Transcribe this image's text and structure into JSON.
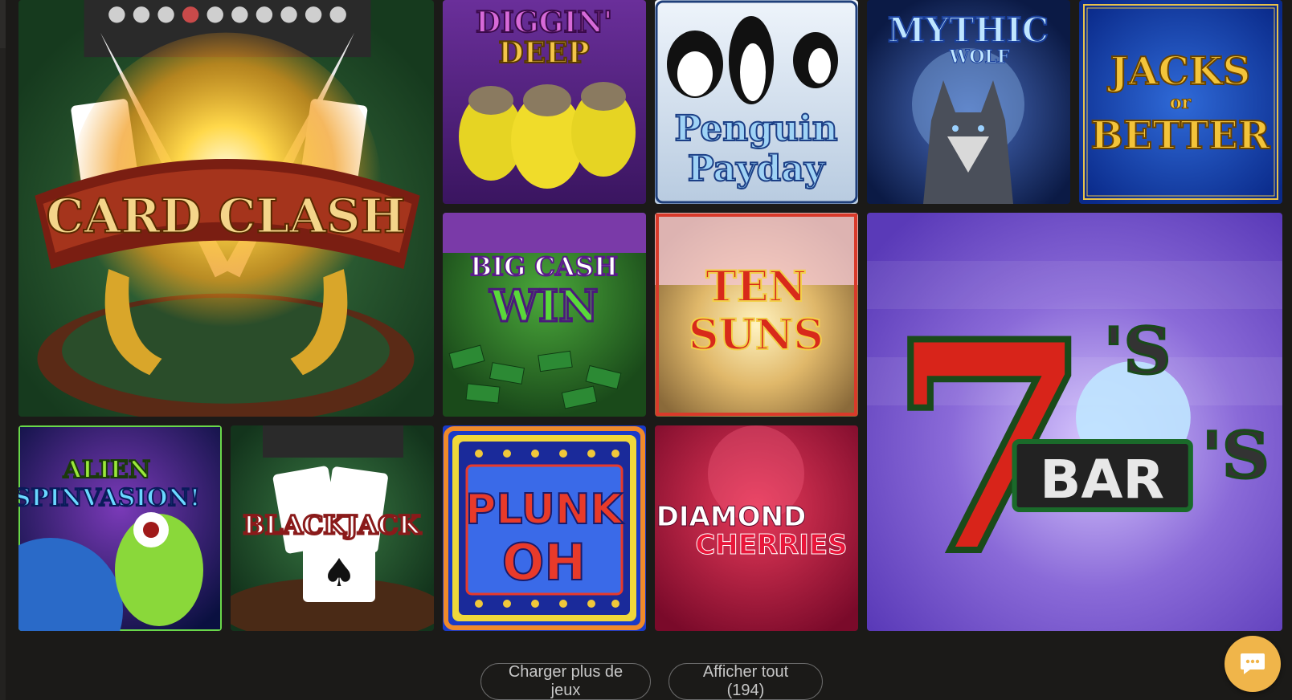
{
  "games": [
    {
      "title": "CARD CLASH"
    },
    {
      "title_line1": "DIGGIN'",
      "title_line2": "DEEP"
    },
    {
      "title_line1": "Penguin",
      "title_line2": "Payday"
    },
    {
      "title_line1": "MYTHIC",
      "title_line2": "WOLF"
    },
    {
      "title_line1": "JACKS",
      "title_line2": "or",
      "title_line3": "BETTER"
    },
    {
      "title_line1": "BIG CASH",
      "title_line2": "WIN"
    },
    {
      "title_line1": "TEN",
      "title_line2": "SUNS"
    },
    {
      "title_big": "7",
      "title_suffix": "'S",
      "title_bar": "BAR"
    },
    {
      "title_line1": "ALIEN",
      "title_line2": "SPINVASION!"
    },
    {
      "title": "BLACKJACK"
    },
    {
      "title_line1": "PLUNK",
      "title_line2": "OH"
    },
    {
      "title_line1": "DIAMOND",
      "title_line2": "CHERRIES"
    }
  ],
  "actions": {
    "load_more": "Charger plus de jeux",
    "show_all": "Afficher tout (194)"
  },
  "icons": {
    "chat": "chat-bubble-icon"
  },
  "colors": {
    "background": "#1b1a18",
    "chat_button": "#f0b54a",
    "pill_border": "#6b6b6b"
  }
}
